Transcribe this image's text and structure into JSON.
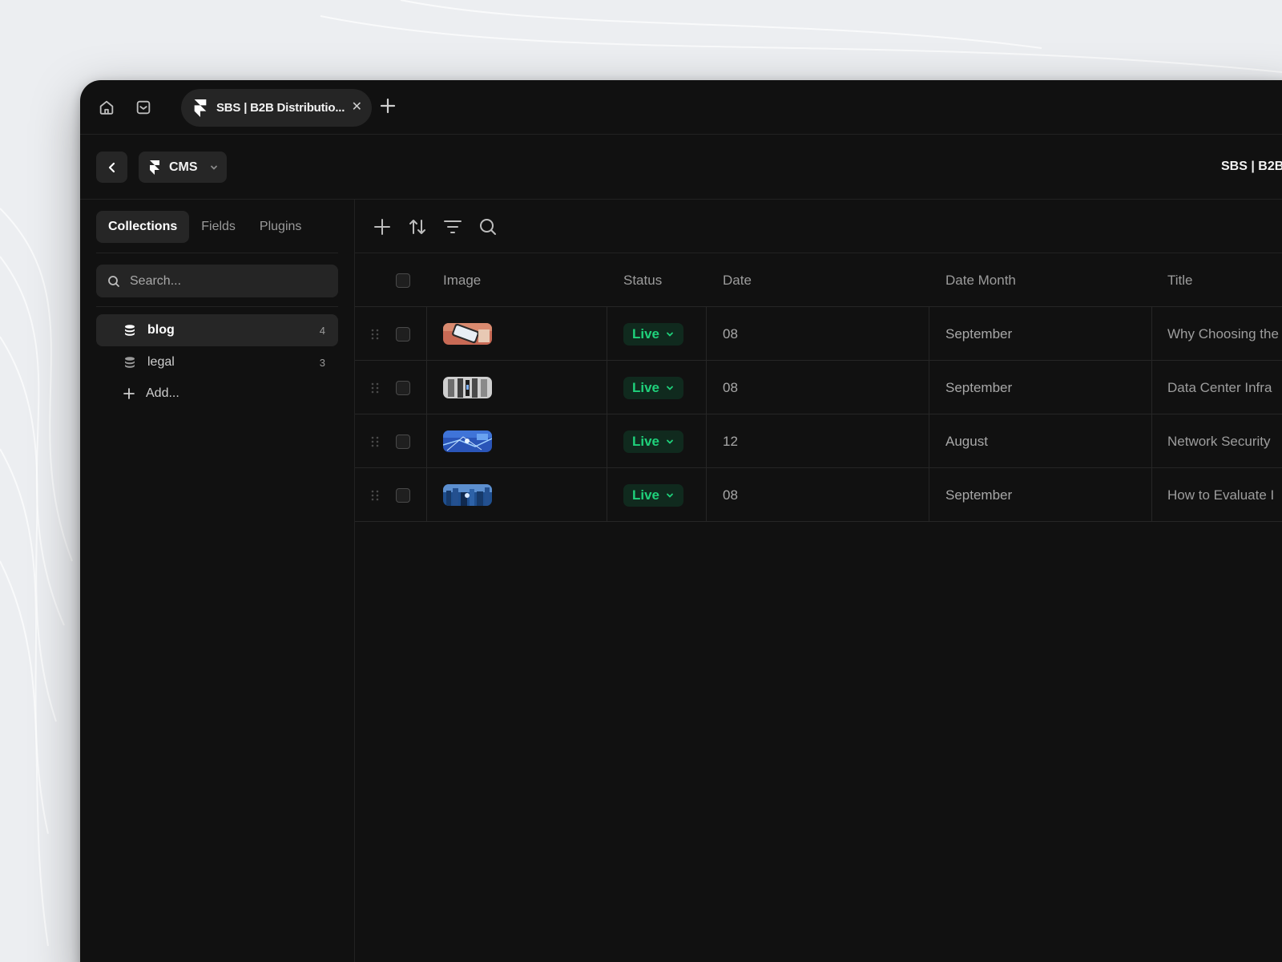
{
  "browser": {
    "tab_title": "SBS | B2B Distributio...",
    "home_icon": "home-icon",
    "pocket_icon": "pocket-icon",
    "close_icon": "close-icon",
    "new_tab_icon": "plus-icon"
  },
  "appbar": {
    "back_icon": "chevron-left-icon",
    "cms_label": "CMS",
    "cms_logo": "framer-logo-icon",
    "chevron": "chevron-down-icon",
    "site_title": "SBS | B2B"
  },
  "sidebar": {
    "tabs": [
      {
        "label": "Collections",
        "active": true
      },
      {
        "label": "Fields",
        "active": false
      },
      {
        "label": "Plugins",
        "active": false
      }
    ],
    "search_placeholder": "Search...",
    "collections": [
      {
        "name": "blog",
        "count": "4",
        "active": true
      },
      {
        "name": "legal",
        "count": "3",
        "active": false
      }
    ],
    "add_label": "Add..."
  },
  "toolbar": {
    "icons": [
      "plus-icon",
      "sort-icon",
      "filter-icon",
      "search-icon"
    ]
  },
  "table": {
    "columns": [
      "Image",
      "Status",
      "Date",
      "Date Month",
      "Title"
    ],
    "rows": [
      {
        "image": "phone-thumbnail",
        "status": "Live",
        "date": "08",
        "month": "September",
        "title": "Why Choosing the"
      },
      {
        "image": "server-thumbnail",
        "status": "Live",
        "date": "08",
        "month": "September",
        "title": "Data Center Infra"
      },
      {
        "image": "network-thumbnail",
        "status": "Live",
        "date": "12",
        "month": "August",
        "title": "Network Security"
      },
      {
        "image": "city-thumbnail",
        "status": "Live",
        "date": "08",
        "month": "September",
        "title": "How to Evaluate I"
      }
    ]
  },
  "colors": {
    "window_bg": "#111111",
    "live_green": "#1fd17b",
    "live_bg": "#102a1e"
  }
}
